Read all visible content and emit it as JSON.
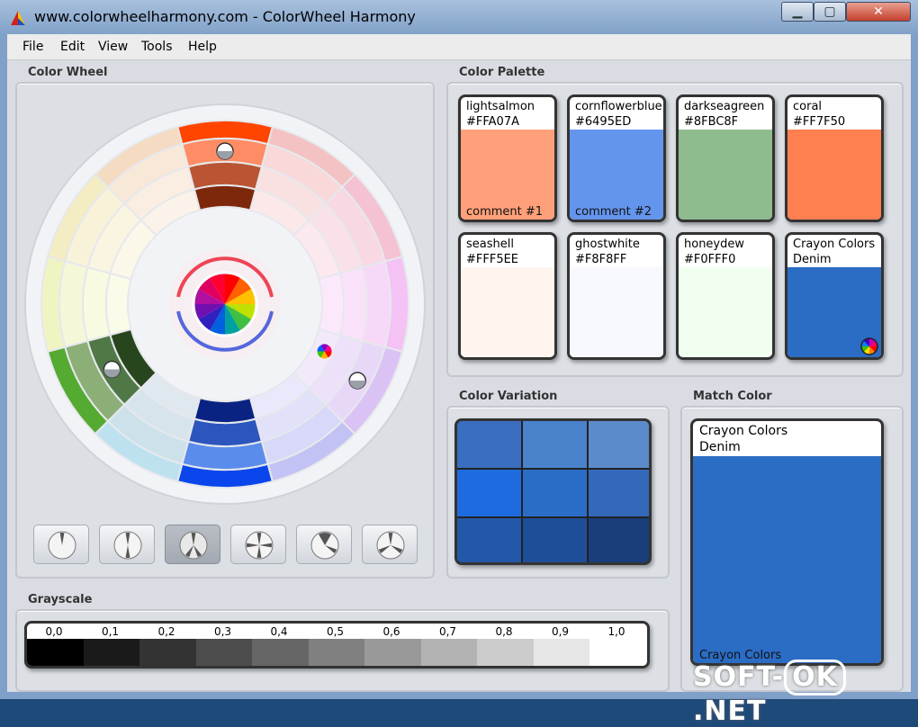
{
  "window": {
    "title": "www.colorwheelharmony.com - ColorWheel Harmony",
    "minimize_label": "▁",
    "maximize_label": "▢",
    "close_label": "✕"
  },
  "menu": [
    "File",
    "Edit",
    "View",
    "Tools",
    "Help"
  ],
  "sections": {
    "color_wheel": "Color Wheel",
    "color_palette": "Color Palette",
    "color_variation": "Color Variation",
    "match_color": "Match Color",
    "grayscale": "Grayscale"
  },
  "harmony_buttons": [
    "analogous-icon",
    "complementary-icon",
    "split-complementary-icon",
    "triad-icon",
    "square-icon",
    "tetrad-icon"
  ],
  "active_harmony_index": 2,
  "palette": [
    {
      "name": "lightsalmon",
      "hex": "#FFA07A",
      "comment": "comment #1"
    },
    {
      "name": "cornflowerblue",
      "hex": "#6495ED",
      "comment": "comment #2"
    },
    {
      "name": "darkseagreen",
      "hex": "#8FBC8F",
      "comment": ""
    },
    {
      "name": "coral",
      "hex": "#FF7F50",
      "comment": ""
    },
    {
      "name": "seashell",
      "hex": "#FFF5EE",
      "comment": ""
    },
    {
      "name": "ghostwhite",
      "hex": "#F8F8FF",
      "comment": ""
    },
    {
      "name": "honeydew",
      "hex": "#F0FFF0",
      "comment": ""
    },
    {
      "name": "Crayon Colors",
      "hex": "Denim",
      "comment": "",
      "swatch": "#2B6CC4",
      "has_wheel_icon": true
    }
  ],
  "variation_colors": [
    "#3A6FC0",
    "#4A82CC",
    "#5B8BCB",
    "#1E6BE0",
    "#2A6DC7",
    "#3468B8",
    "#2358A8",
    "#1F4E98",
    "#1A3E7A"
  ],
  "match": {
    "name": "Crayon Colors",
    "sub": "Denim",
    "footer": "Crayon Colors",
    "swatch": "#2B6CC4"
  },
  "grayscale": {
    "labels": [
      "0,0",
      "0,1",
      "0,2",
      "0,3",
      "0,4",
      "0,5",
      "0,6",
      "0,7",
      "0,8",
      "0,9",
      "1,0"
    ],
    "shades": [
      "#000000",
      "#1a1a1a",
      "#333333",
      "#4d4d4d",
      "#666666",
      "#808080",
      "#999999",
      "#b3b3b3",
      "#cccccc",
      "#e6e6e6",
      "#ffffff"
    ]
  },
  "watermark": {
    "left": "SOFT-",
    "ok": "OK",
    "right": ".NET"
  }
}
